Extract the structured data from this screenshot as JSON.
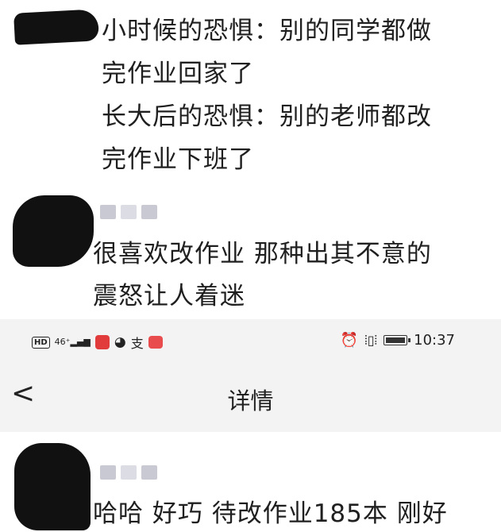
{
  "comments": [
    {
      "lines": [
        "小时候的恐惧：别的同学都做",
        "完作业回家了",
        "长大后的恐惧：别的老师都改",
        "完作业下班了"
      ]
    },
    {
      "lines": [
        "很喜欢改作业 那种出其不意的",
        "震怒让人着迷"
      ]
    },
    {
      "lines": [
        "哈哈 好巧 待改作业185本 刚好"
      ]
    }
  ],
  "statusbar": {
    "hd": "HD",
    "network": "46⁺",
    "time": "10:37",
    "battery_level": 0.85,
    "icons": [
      "hd-icon",
      "signal-icon",
      "book-app-icon",
      "browser-app-icon",
      "alipay-app-icon",
      "notification-app-icon",
      "alarm-icon",
      "vibrate-icon",
      "battery-icon"
    ]
  },
  "navbar": {
    "back": "<",
    "title": "详情"
  }
}
